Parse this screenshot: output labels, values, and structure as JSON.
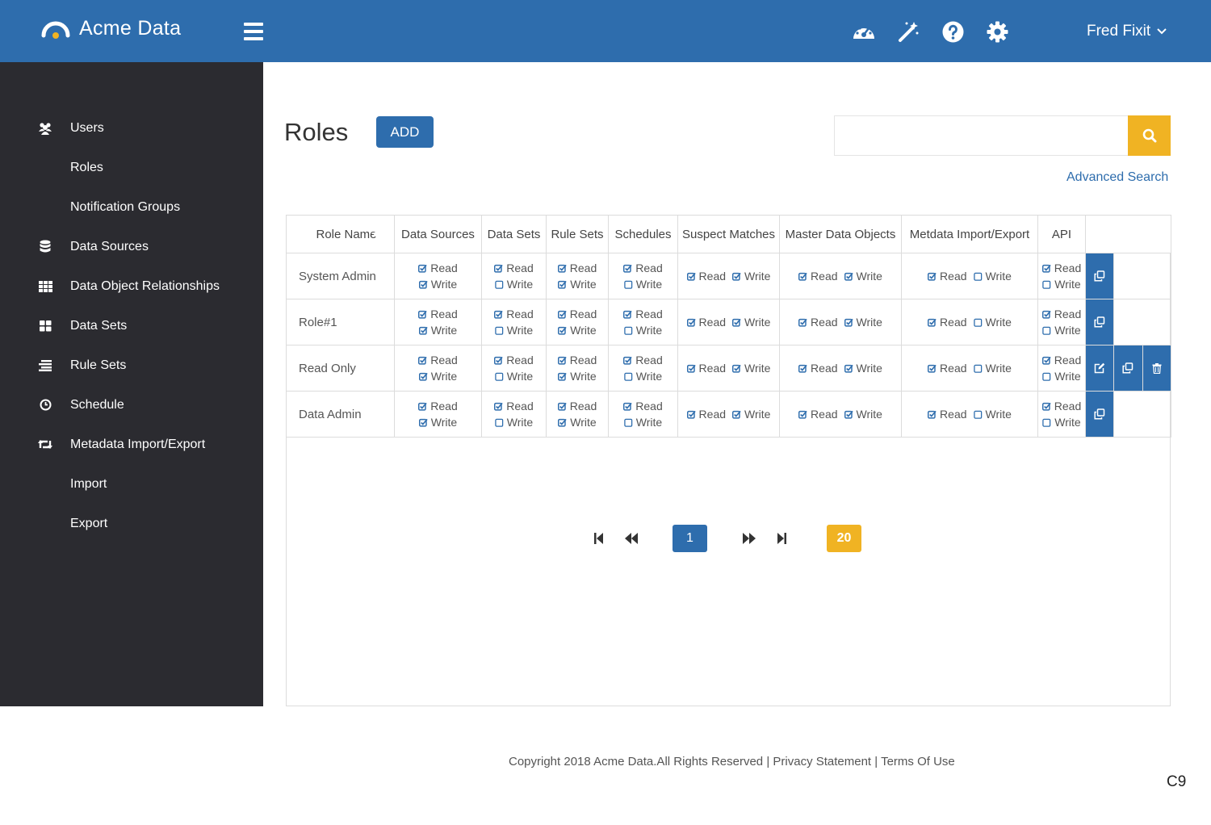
{
  "header": {
    "brand": "Acme Data",
    "user_name": "Fred Fixit",
    "icons": [
      "dashboard-icon",
      "magic-wand-icon",
      "help-icon",
      "gear-icon"
    ]
  },
  "sidebar": {
    "items": [
      {
        "label": "Users",
        "icon": "users-icon"
      },
      {
        "label": "Roles",
        "icon": ""
      },
      {
        "label": "Notification Groups",
        "icon": ""
      },
      {
        "label": "Data Sources",
        "icon": "database-icon"
      },
      {
        "label": "Data Object Relationships",
        "icon": "grid-icon"
      },
      {
        "label": "Data Sets",
        "icon": "tiles-icon"
      },
      {
        "label": "Rule Sets",
        "icon": "list-icon"
      },
      {
        "label": "Schedule",
        "icon": "clock-icon"
      },
      {
        "label": "Metadata Import/Export",
        "icon": "retweet-icon"
      },
      {
        "label": "Import",
        "icon": ""
      },
      {
        "label": "Export",
        "icon": ""
      }
    ]
  },
  "main": {
    "title": "Roles",
    "add_label": "ADD",
    "search_placeholder": "",
    "advanced_search": "Advanced Search"
  },
  "table": {
    "columns": [
      "Role Name",
      "Data Sources",
      "Data Sets",
      "Rule Sets",
      "Schedules",
      "Suspect Matches",
      "Master Data Objects",
      "Metdata Import/Export",
      "API"
    ],
    "read_label": "Read",
    "write_label": "Write",
    "rows": [
      {
        "name": "System Admin",
        "perms": [
          [
            true,
            true
          ],
          [
            true,
            false
          ],
          [
            true,
            true
          ],
          [
            true,
            false
          ],
          [
            true,
            true
          ],
          [
            true,
            true
          ],
          [
            true,
            false
          ],
          [
            true,
            false
          ]
        ],
        "actions": [
          "copy"
        ]
      },
      {
        "name": "Role#1",
        "perms": [
          [
            true,
            true
          ],
          [
            true,
            false
          ],
          [
            true,
            true
          ],
          [
            true,
            false
          ],
          [
            true,
            true
          ],
          [
            true,
            true
          ],
          [
            true,
            false
          ],
          [
            true,
            false
          ]
        ],
        "actions": [
          "copy"
        ]
      },
      {
        "name": "Read Only",
        "perms": [
          [
            true,
            true
          ],
          [
            true,
            false
          ],
          [
            true,
            true
          ],
          [
            true,
            false
          ],
          [
            true,
            true
          ],
          [
            true,
            true
          ],
          [
            true,
            false
          ],
          [
            true,
            false
          ]
        ],
        "actions": [
          "edit",
          "copy",
          "delete"
        ]
      },
      {
        "name": "Data Admin",
        "perms": [
          [
            true,
            true
          ],
          [
            true,
            false
          ],
          [
            true,
            true
          ],
          [
            true,
            false
          ],
          [
            true,
            true
          ],
          [
            true,
            true
          ],
          [
            true,
            false
          ],
          [
            true,
            false
          ]
        ],
        "actions": [
          "copy"
        ]
      }
    ]
  },
  "pagination": {
    "current_page": "1",
    "page_size": "20"
  },
  "footer": {
    "copyright": "Copyright 2018 Acme Data.All Rights Reserved",
    "separator": " | ",
    "privacy": "Privacy Statement",
    "terms": "Terms Of Use"
  },
  "corner_code": "C9",
  "colors": {
    "primary": "#2e6dad",
    "accent": "#f0b323",
    "sidebar": "#2b2b30"
  }
}
